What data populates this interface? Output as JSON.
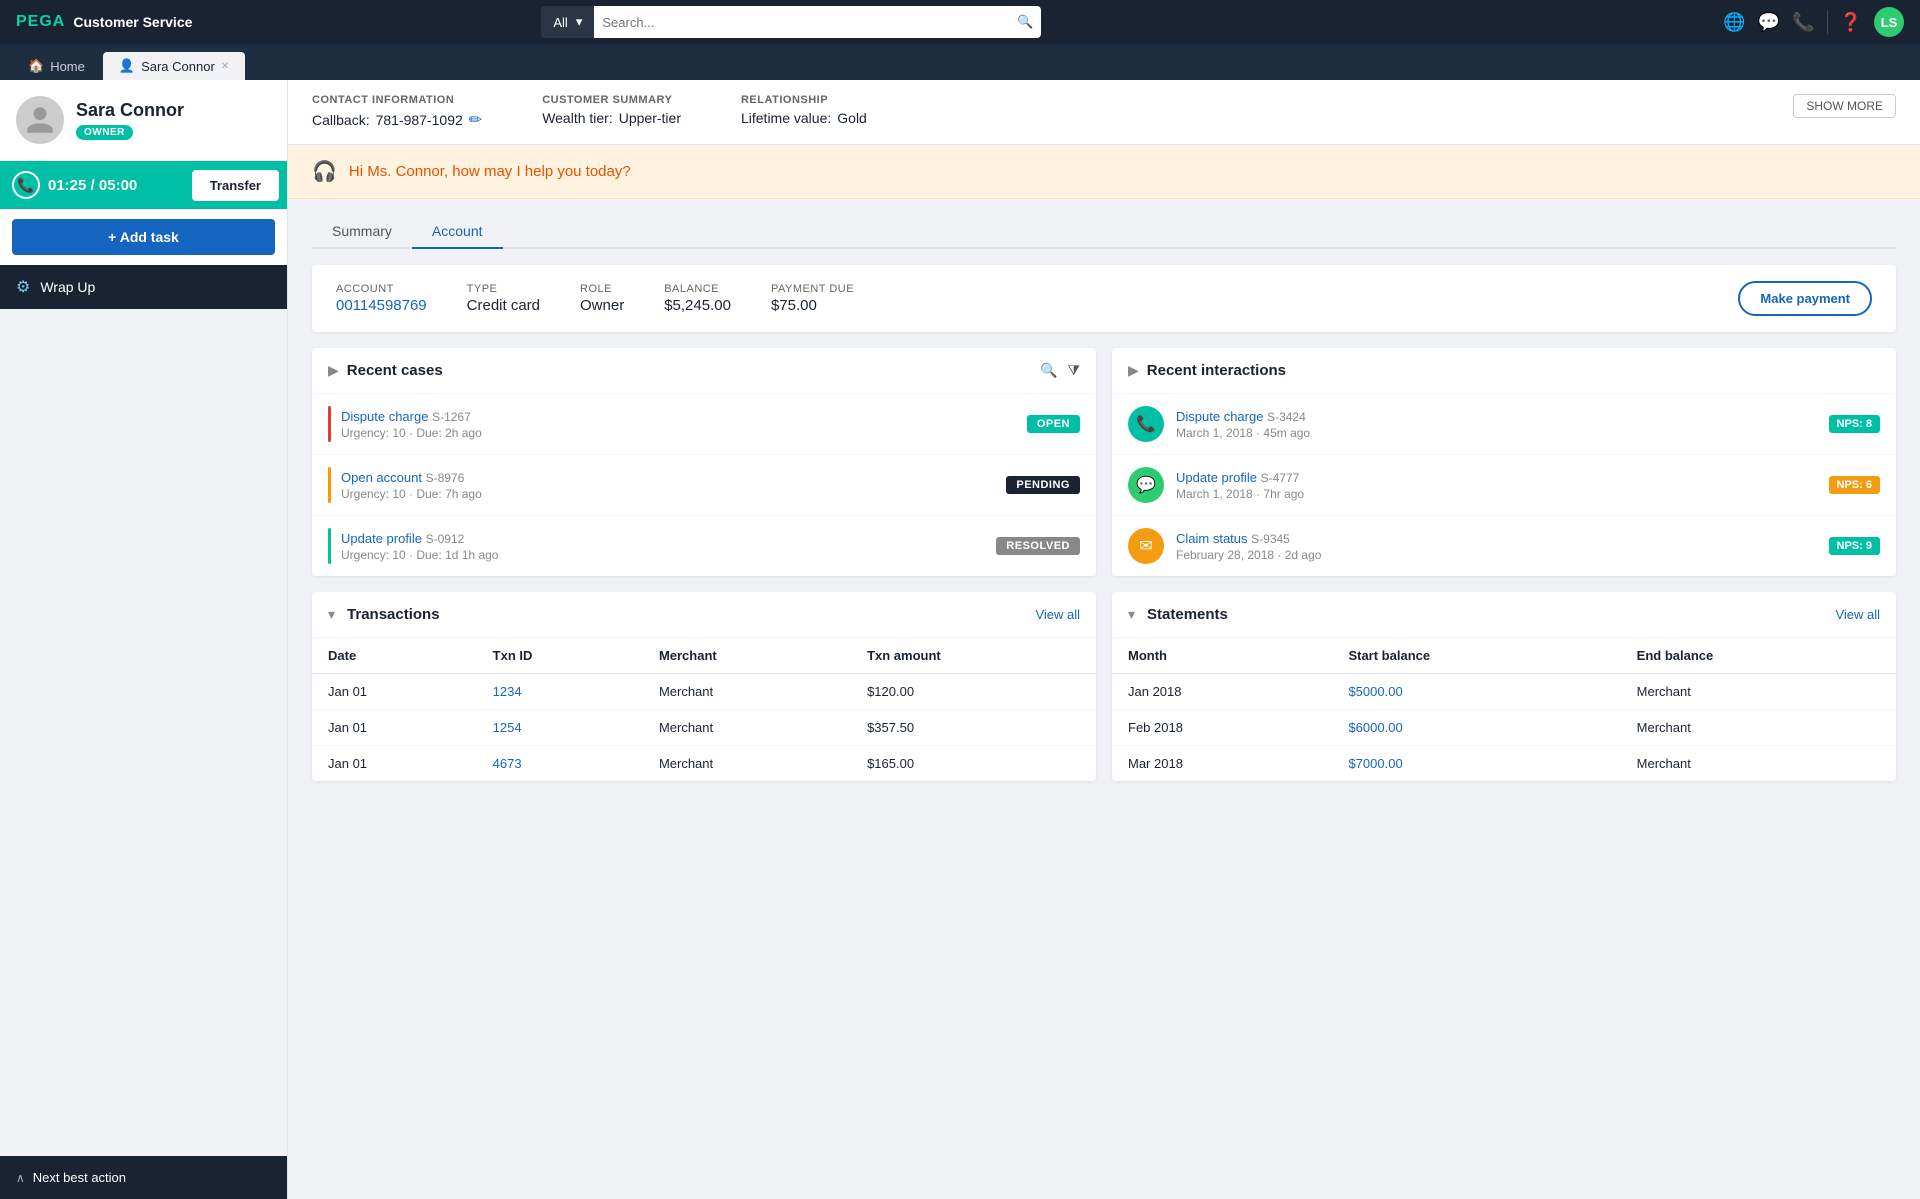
{
  "topNav": {
    "brand": "PEGA",
    "appName": "Customer Service",
    "searchPlaceholder": "Search...",
    "searchDropdown": "All",
    "icons": {
      "globe": "🌐",
      "message": "💬",
      "phone": "📞",
      "help": "?",
      "userInitials": "LS"
    }
  },
  "tabs": [
    {
      "label": "Home",
      "active": false,
      "closeable": false
    },
    {
      "label": "Sara Connor",
      "active": true,
      "closeable": true
    }
  ],
  "sidebar": {
    "customerName": "Sara Connor",
    "ownerBadge": "OWNER",
    "timerCurrent": "01:25",
    "timerTotal": "05:00",
    "transferLabel": "Transfer",
    "addTaskLabel": "+ Add task",
    "wrapUpLabel": "Wrap Up",
    "nextBestAction": "Next best action"
  },
  "customerInfo": {
    "contactInfo": {
      "label": "CONTACT INFORMATION",
      "callbackLabel": "Callback:",
      "callbackValue": "781-987-1092"
    },
    "customerSummary": {
      "label": "CUSTOMER SUMMARY",
      "wealthTierLabel": "Wealth tier:",
      "wealthTierValue": "Upper-tier"
    },
    "relationship": {
      "label": "RELATIONSHIP",
      "lifetimeValueLabel": "Lifetime value:",
      "lifetimeValueValue": "Gold"
    },
    "showMore": "SHOW MORE"
  },
  "greeting": "Hi Ms. Connor, how may I help you today?",
  "viewTabs": [
    {
      "label": "Summary",
      "active": false
    },
    {
      "label": "Account",
      "active": true
    }
  ],
  "accountSummary": {
    "accountLabel": "ACCOUNT",
    "accountNumber": "00114598769",
    "typeLabel": "TYPE",
    "typeValue": "Credit card",
    "roleLabel": "ROLE",
    "roleValue": "Owner",
    "balanceLabel": "BALANCE",
    "balanceValue": "$5,245.00",
    "paymentDueLabel": "PAYMENT DUE",
    "paymentDueValue": "$75.00",
    "makePaymentLabel": "Make payment"
  },
  "recentCases": {
    "title": "Recent cases",
    "cases": [
      {
        "name": "Dispute charge",
        "id": "S-1267",
        "urgency": 10,
        "due": "2h ago",
        "status": "OPEN",
        "urgencyColor": "#e53935"
      },
      {
        "name": "Open account",
        "id": "S-8976",
        "urgency": 10,
        "due": "7h ago",
        "status": "PENDING",
        "urgencyColor": "#ff9800"
      },
      {
        "name": "Update profile",
        "id": "S-0912",
        "urgency": 10,
        "due": "1d 1h ago",
        "status": "RESOLVED",
        "urgencyColor": "#00bfa5"
      }
    ]
  },
  "recentInteractions": {
    "title": "Recent interactions",
    "interactions": [
      {
        "type": "phone",
        "name": "Dispute charge",
        "id": "S-3424",
        "date": "March 1, 2018",
        "timeAgo": "45m ago",
        "nps": "NPS: 8",
        "npsColor": "green"
      },
      {
        "type": "chat",
        "name": "Update profile",
        "id": "S-4777",
        "date": "March 1, 2018",
        "timeAgo": "7hr ago",
        "nps": "NPS: 6",
        "npsColor": "yellow"
      },
      {
        "type": "email",
        "name": "Claim status",
        "id": "S-9345",
        "date": "February 28, 2018",
        "timeAgo": "2d ago",
        "nps": "NPS: 9",
        "npsColor": "green"
      }
    ]
  },
  "transactions": {
    "title": "Transactions",
    "viewAll": "View all",
    "columns": [
      "Date",
      "Txn ID",
      "Merchant",
      "Txn amount"
    ],
    "rows": [
      {
        "date": "Jan 01",
        "txnId": "1234",
        "merchant": "Merchant",
        "amount": "$120.00"
      },
      {
        "date": "Jan 01",
        "txnId": "1254",
        "merchant": "Merchant",
        "amount": "$357.50"
      },
      {
        "date": "Jan 01",
        "txnId": "4673",
        "merchant": "Merchant",
        "amount": "$165.00"
      }
    ]
  },
  "statements": {
    "title": "Statements",
    "viewAll": "View all",
    "columns": [
      "Month",
      "Start balance",
      "End balance"
    ],
    "rows": [
      {
        "month": "Jan 2018",
        "startBalance": "$5000.00",
        "endBalance": "Merchant"
      },
      {
        "month": "Feb 2018",
        "startBalance": "$6000.00",
        "endBalance": "Merchant"
      },
      {
        "month": "Mar 2018",
        "startBalance": "$7000.00",
        "endBalance": "Merchant"
      }
    ]
  }
}
